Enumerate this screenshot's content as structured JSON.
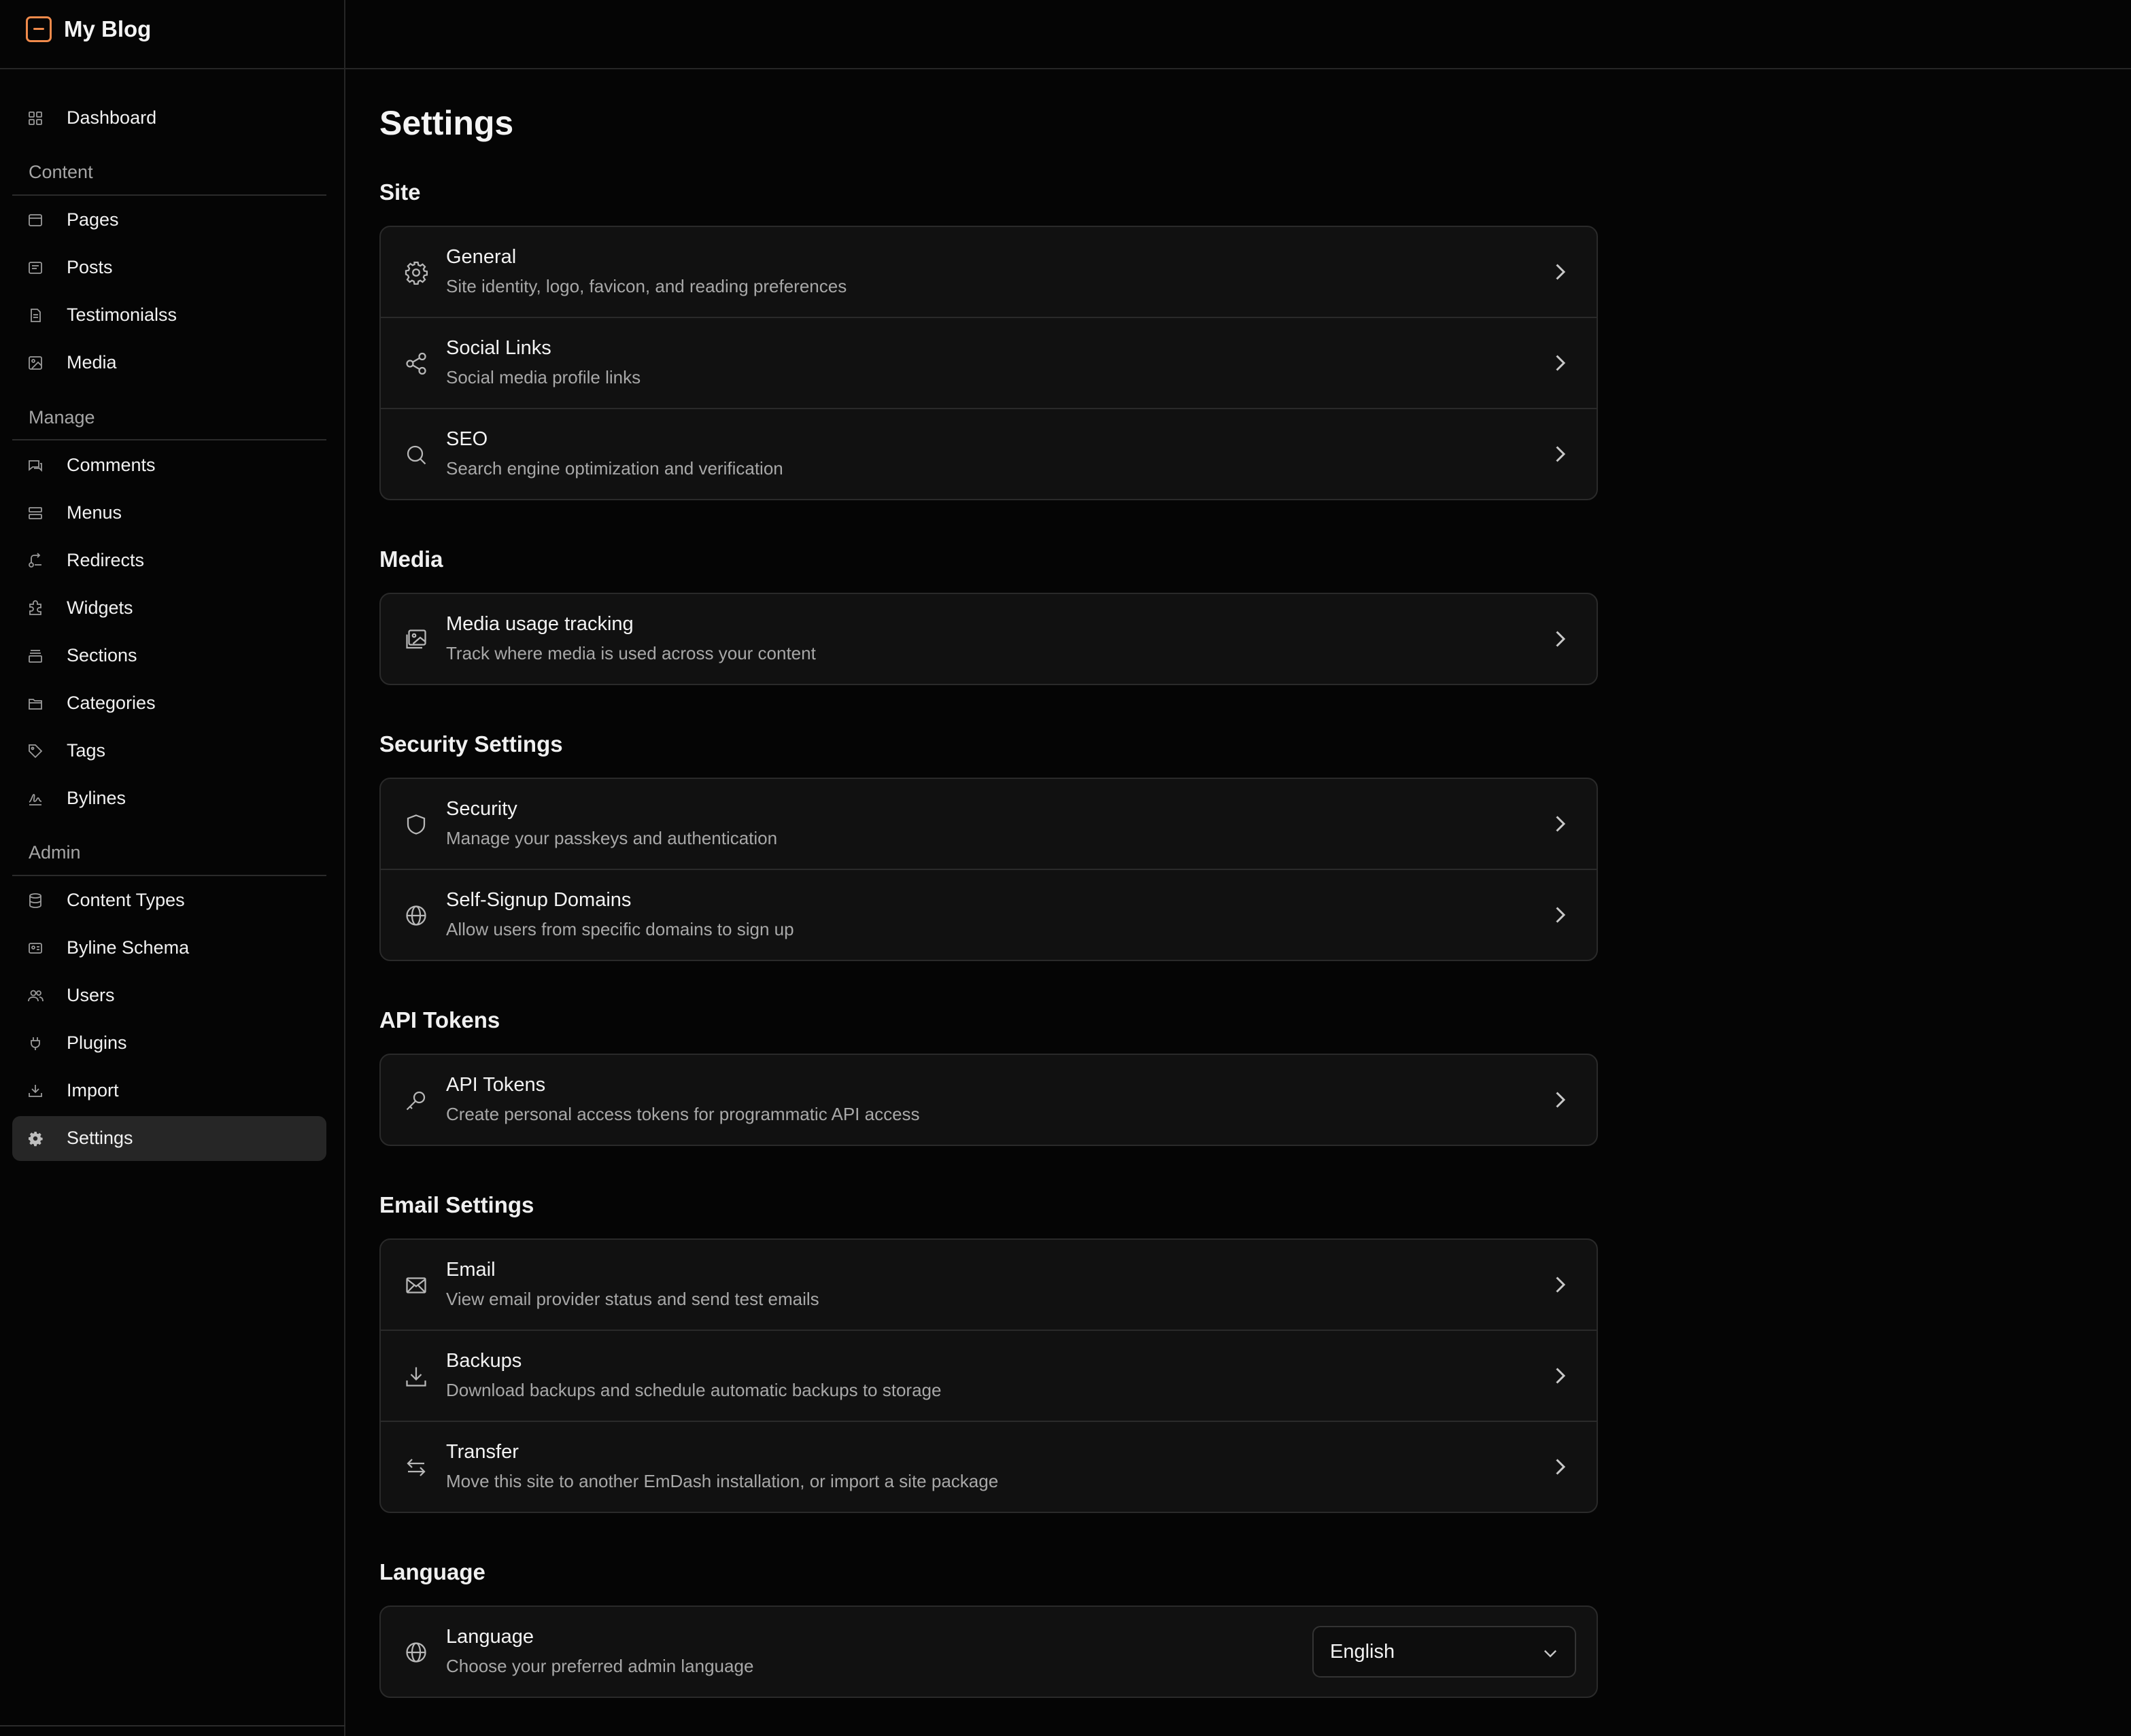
{
  "app": {
    "title": "My Blog"
  },
  "sidebar": {
    "dashboard": {
      "label": "Dashboard",
      "icon": "grid-icon"
    },
    "sections": {
      "content": "Content",
      "manage": "Manage",
      "admin": "Admin"
    },
    "content_items": [
      {
        "label": "Pages",
        "icon": "page-icon"
      },
      {
        "label": "Posts",
        "icon": "post-icon"
      },
      {
        "label": "Testimonialss",
        "icon": "testimonial-icon"
      },
      {
        "label": "Media",
        "icon": "image-icon"
      }
    ],
    "manage_items": [
      {
        "label": "Comments",
        "icon": "comments-icon"
      },
      {
        "label": "Menus",
        "icon": "menu-icon"
      },
      {
        "label": "Redirects",
        "icon": "redirect-icon"
      },
      {
        "label": "Widgets",
        "icon": "widget-icon"
      },
      {
        "label": "Sections",
        "icon": "sections-icon"
      },
      {
        "label": "Categories",
        "icon": "folder-icon"
      },
      {
        "label": "Tags",
        "icon": "tag-icon"
      },
      {
        "label": "Bylines",
        "icon": "signature-icon"
      }
    ],
    "admin_items": [
      {
        "label": "Content Types",
        "icon": "database-icon"
      },
      {
        "label": "Byline Schema",
        "icon": "id-card-icon"
      },
      {
        "label": "Users",
        "icon": "users-icon"
      },
      {
        "label": "Plugins",
        "icon": "plug-icon"
      },
      {
        "label": "Import",
        "icon": "import-icon"
      },
      {
        "label": "Settings",
        "icon": "gear-icon",
        "active": true
      }
    ]
  },
  "main": {
    "title": "Settings",
    "groups": {
      "site": {
        "heading": "Site",
        "rows": [
          {
            "title": "General",
            "desc": "Site identity, logo, favicon, and reading preferences",
            "icon": "gear-icon"
          },
          {
            "title": "Social Links",
            "desc": "Social media profile links",
            "icon": "share-icon"
          },
          {
            "title": "SEO",
            "desc": "Search engine optimization and verification",
            "icon": "search-icon"
          }
        ]
      },
      "media": {
        "heading": "Media",
        "rows": [
          {
            "title": "Media usage tracking",
            "desc": "Track where media is used across your content",
            "icon": "images-icon"
          }
        ]
      },
      "security": {
        "heading": "Security Settings",
        "rows": [
          {
            "title": "Security",
            "desc": "Manage your passkeys and authentication",
            "icon": "shield-icon"
          },
          {
            "title": "Self-Signup Domains",
            "desc": "Allow users from specific domains to sign up",
            "icon": "globe-icon"
          }
        ]
      },
      "api": {
        "heading": "API Tokens",
        "rows": [
          {
            "title": "API Tokens",
            "desc": "Create personal access tokens for programmatic API access",
            "icon": "key-icon"
          }
        ]
      },
      "email": {
        "heading": "Email Settings",
        "rows": [
          {
            "title": "Email",
            "desc": "View email provider status and send test emails",
            "icon": "envelope-icon"
          },
          {
            "title": "Backups",
            "desc": "Download backups and schedule automatic backups to storage",
            "icon": "download-icon"
          },
          {
            "title": "Transfer",
            "desc": "Move this site to another EmDash installation, or import a site package",
            "icon": "transfer-icon"
          }
        ]
      },
      "language": {
        "heading": "Language",
        "rows": [
          {
            "title": "Language",
            "desc": "Choose your preferred admin language",
            "icon": "globe-icon"
          }
        ],
        "selected": "English"
      }
    }
  },
  "colors": {
    "background": "#050505",
    "card": "#111111",
    "border": "#2a2a2a",
    "brand_accent": "#f08a4b",
    "active_item": "#262626"
  }
}
